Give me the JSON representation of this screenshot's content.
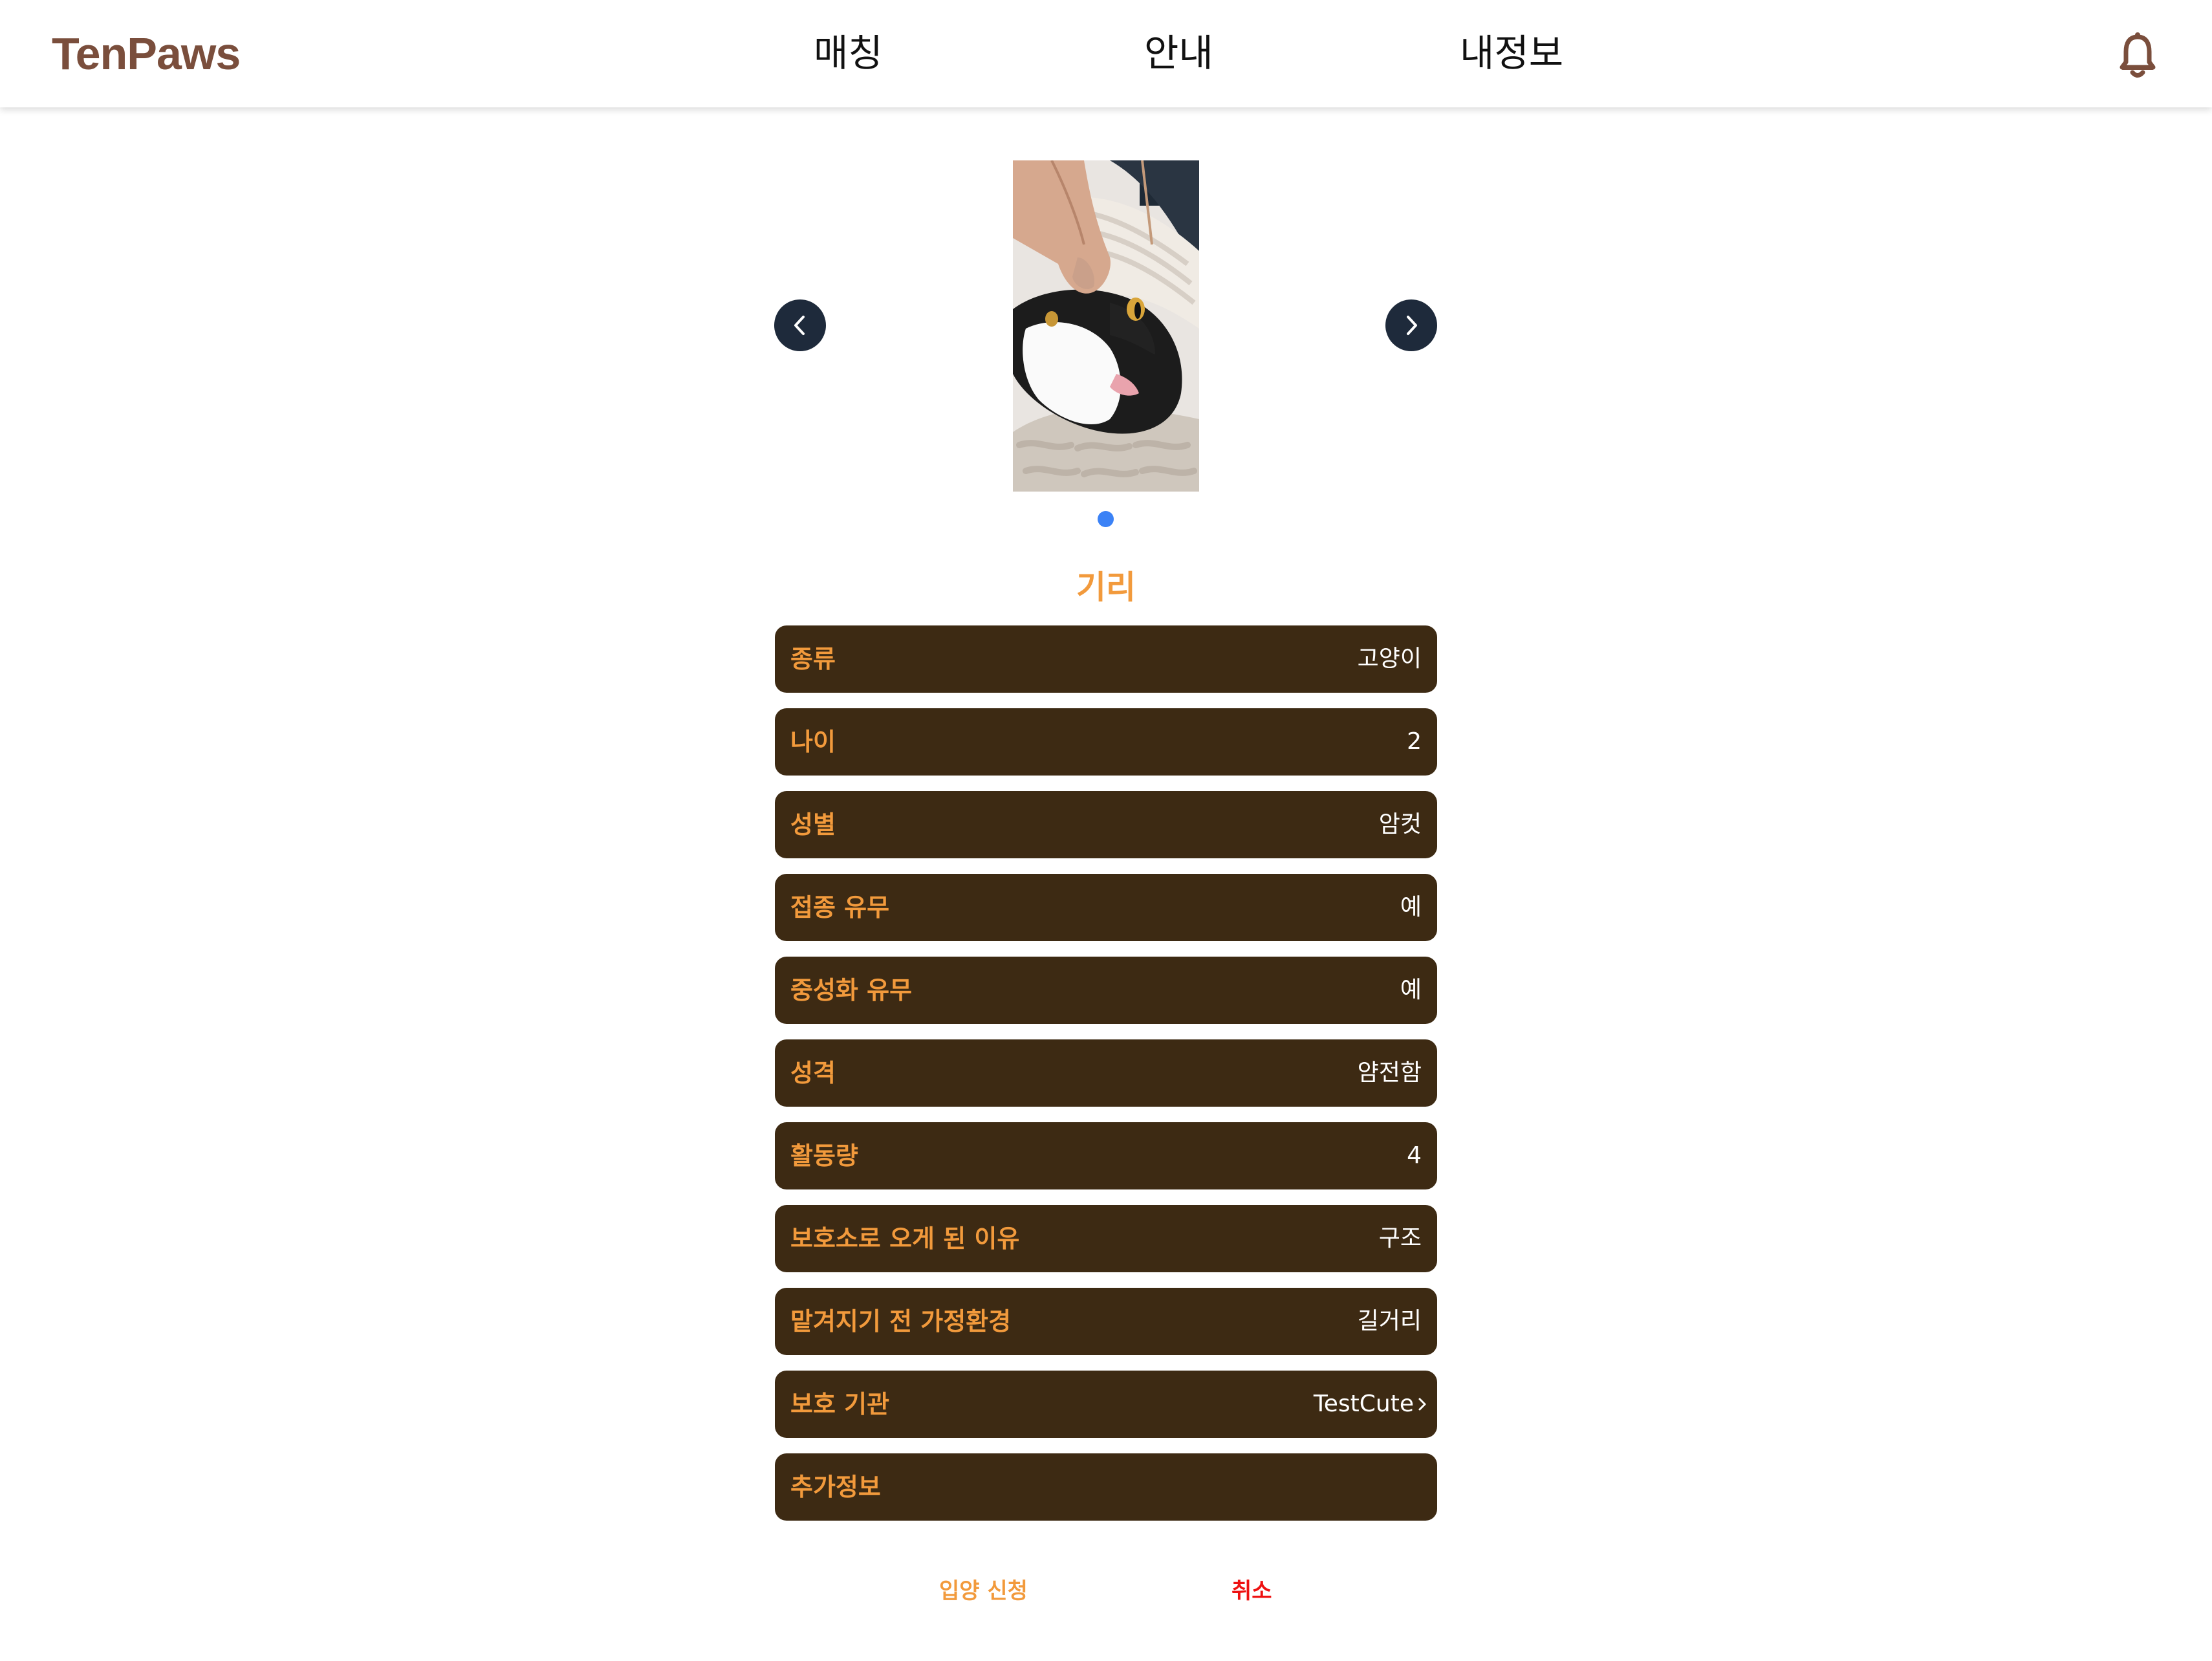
{
  "header": {
    "logo": "TenPaws",
    "nav": [
      "매칭",
      "안내",
      "내정보"
    ],
    "notification_icon": "bell-icon"
  },
  "carousel": {
    "image_description": "black and white cat lying in a white knitted blanket being petted",
    "prev_icon": "chevron-left-icon",
    "next_icon": "chevron-right-icon",
    "dot_count": 1,
    "active_dot": 0
  },
  "pet": {
    "name": "기리",
    "info": [
      {
        "label": "종류",
        "value": "고양이"
      },
      {
        "label": "나이",
        "value": "2"
      },
      {
        "label": "성별",
        "value": "암컷"
      },
      {
        "label": "접종 유무",
        "value": "예"
      },
      {
        "label": "중성화 유무",
        "value": "예"
      },
      {
        "label": "성격",
        "value": "얌전함"
      },
      {
        "label": "활동량",
        "value": "4"
      },
      {
        "label": "보호소로 오게 된 이유",
        "value": "구조"
      },
      {
        "label": "맡겨지기 전 가정환경",
        "value": "길거리"
      },
      {
        "label": "보호 기관",
        "value": "TestCute"
      },
      {
        "label": "추가정보",
        "value": ""
      }
    ]
  },
  "actions": {
    "apply": "입양 신청",
    "cancel": "취소"
  },
  "colors": {
    "brand": "#7a4e3c",
    "accent": "#f29a3c",
    "row_background": "#3d2a13",
    "cancel": "#ee1111",
    "carousel_button": "#1e2a3b",
    "dot_active": "#3b82f6"
  }
}
